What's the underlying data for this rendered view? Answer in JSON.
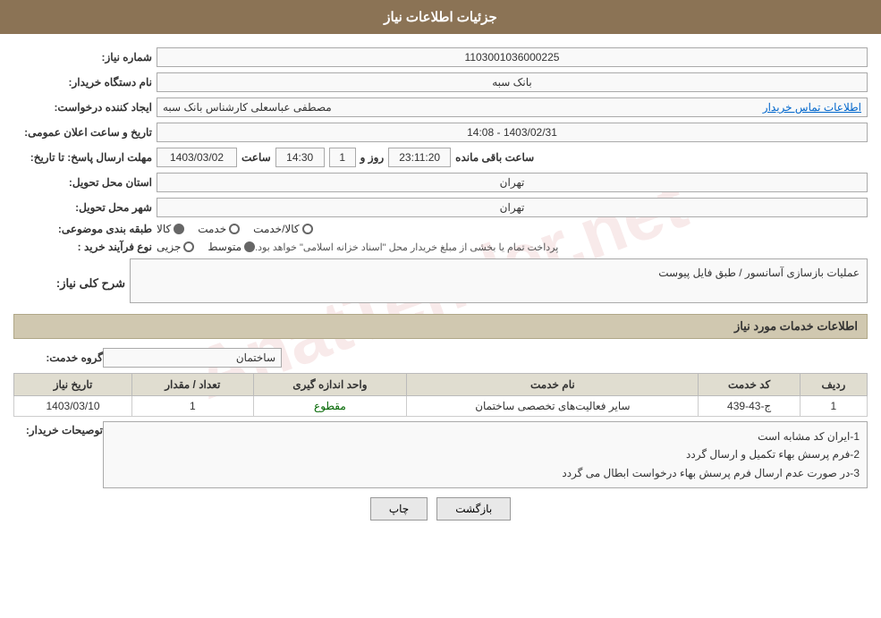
{
  "header": {
    "title": "جزئیات اطلاعات نیاز"
  },
  "form": {
    "need_number_label": "شماره نیاز:",
    "need_number_value": "1103001036000225",
    "buyer_org_label": "نام دستگاه خریدار:",
    "buyer_org_value": "بانک سبه",
    "creator_label": "ایجاد کننده درخواست:",
    "creator_value": "مصطفی عباسعلی کارشناس بانک سبه",
    "contact_link": "اطلاعات تماس خریدار",
    "announce_date_label": "تاریخ و ساعت اعلان عمومی:",
    "announce_date_value": "1403/02/31 - 14:08",
    "deadline_label": "مهلت ارسال پاسخ: تا تاریخ:",
    "deadline_date": "1403/03/02",
    "deadline_time_label": "ساعت",
    "deadline_time": "14:30",
    "deadline_days_label": "روز و",
    "deadline_days": "1",
    "deadline_remaining_label": "ساعت باقی مانده",
    "deadline_remaining": "23:11:20",
    "province_label": "استان محل تحویل:",
    "province_value": "تهران",
    "city_label": "شهر محل تحویل:",
    "city_value": "تهران",
    "category_label": "طبقه بندی موضوعی:",
    "category_options": [
      {
        "label": "کالا",
        "selected": true
      },
      {
        "label": "خدمت",
        "selected": false
      },
      {
        "label": "کالا/خدمت",
        "selected": false
      }
    ],
    "process_label": "نوع فرآیند خرید :",
    "process_options": [
      {
        "label": "جزیی",
        "selected": false
      },
      {
        "label": "متوسط",
        "selected": true
      },
      {
        "label": "",
        "selected": false
      }
    ],
    "process_note": "پرداخت تمام یا بخشی از مبلغ خریدار محل \"اسناد خزانه اسلامی\" خواهد بود.",
    "description_label": "شرح کلی نیاز:",
    "description_value": "عملیات بازسازی آسانسور / طبق فایل پیوست",
    "services_section_title": "اطلاعات خدمات مورد نیاز",
    "service_group_label": "گروه خدمت:",
    "service_group_value": "ساختمان",
    "table": {
      "headers": [
        "ردیف",
        "کد خدمت",
        "نام خدمت",
        "واحد اندازه گیری",
        "تعداد / مقدار",
        "تاریخ نیاز"
      ],
      "rows": [
        {
          "row": "1",
          "code": "ج-43-439",
          "name": "سایر فعالیت‌های تخصصی ساختمان",
          "unit": "مقطوع",
          "quantity": "1",
          "date": "1403/03/10"
        }
      ]
    },
    "buyer_notes_label": "توصیحات خریدار:",
    "buyer_notes_lines": [
      "1-ایران کد مشابه است",
      "2-فرم پرسش بهاء تکمیل و ارسال گردد",
      "3-در صورت عدم ارسال فرم پرسش بهاء درخواست ابطال می گردد"
    ]
  },
  "buttons": {
    "print_label": "چاپ",
    "back_label": "بازگشت"
  },
  "watermark": "AnatTender.net"
}
